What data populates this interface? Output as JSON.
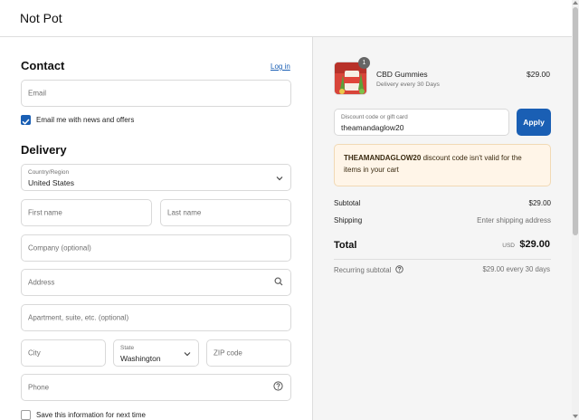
{
  "store": {
    "name": "Not Pot"
  },
  "contact": {
    "title": "Contact",
    "login_link": "Log in",
    "email_placeholder": "Email",
    "newsletter_label": "Email me with news and offers",
    "newsletter_checked": true
  },
  "delivery": {
    "title": "Delivery",
    "country_label": "Country/Region",
    "country_value": "United States",
    "first_name_placeholder": "First name",
    "last_name_placeholder": "Last name",
    "company_placeholder": "Company (optional)",
    "address_placeholder": "Address",
    "apartment_placeholder": "Apartment, suite, etc. (optional)",
    "city_placeholder": "City",
    "state_label": "State",
    "state_value": "Washington",
    "zip_placeholder": "ZIP code",
    "phone_placeholder": "Phone",
    "save_info_label": "Save this information for next time",
    "save_info_checked": false
  },
  "summary": {
    "product": {
      "name": "CBD Gummies",
      "subtitle": "Delivery every 30 Days",
      "price": "$29.00",
      "quantity": "1"
    },
    "discount": {
      "label": "Discount code or gift card",
      "value": "theamandaglow20",
      "apply_label": "Apply"
    },
    "alert": {
      "code": "THEAMANDAGLOW20",
      "message": " discount code isn't valid for the items in your cart"
    },
    "subtotal_label": "Subtotal",
    "subtotal_value": "$29.00",
    "shipping_label": "Shipping",
    "shipping_value": "Enter shipping address",
    "total_label": "Total",
    "total_currency": "USD",
    "total_value": "$29.00",
    "recurring_label": "Recurring subtotal",
    "recurring_value": "$29.00 every 30 days"
  },
  "colors": {
    "accent": "#1a5fb4",
    "alert_bg": "#fff5e8",
    "summary_bg": "#f5f5f5"
  }
}
